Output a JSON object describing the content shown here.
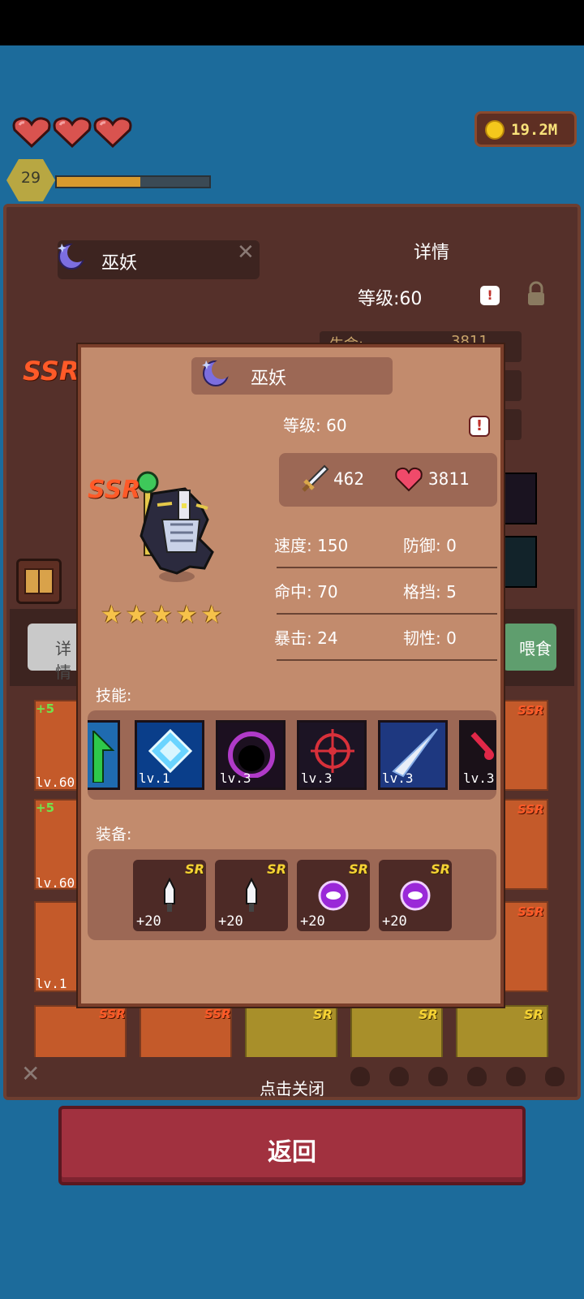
{
  "hud": {
    "hearts": 3,
    "gold": "19.2M",
    "player_level": "29",
    "xp_fraction": 0.55
  },
  "background_panel": {
    "hero_name": "巫妖",
    "detail_title": "详情",
    "level_label": "等级:60",
    "row1_label": "生命:",
    "row1_value": "3811",
    "tab_left": "详情",
    "tab_right": "喂食",
    "cards": [
      {
        "lv": "lv.60",
        "bonus": "+5"
      },
      {
        "lv": "lv.60",
        "bonus": "+5"
      },
      {
        "lv": "lv.1",
        "bonus": ""
      }
    ],
    "rarity_ssr": "SSR",
    "rarity_sr": "SR"
  },
  "popup": {
    "name": "巫妖",
    "level": "等级: 60",
    "rarity": "SSR",
    "stars": 5,
    "attack": "462",
    "hp": "3811",
    "stats": [
      [
        "速度: 150",
        "防御: 0"
      ],
      [
        "命中: 70",
        "格挡: 5"
      ],
      [
        "暴击: 24",
        "韧性: 0"
      ]
    ],
    "skills_label": "技能:",
    "skills": [
      {
        "lv": "",
        "icon": "green-arrow-icon"
      },
      {
        "lv": "lv.1",
        "icon": "blue-crystal-icon"
      },
      {
        "lv": "lv.3",
        "icon": "dark-vortex-icon"
      },
      {
        "lv": "lv.3",
        "icon": "crosshair-icon"
      },
      {
        "lv": "lv.3",
        "icon": "blade-slash-icon"
      },
      {
        "lv": "lv.3",
        "icon": "blood-drop-icon"
      }
    ],
    "equipment_label": "装备:",
    "equipment": [
      {
        "plus": "+20",
        "rarity": "SR",
        "icon": "dagger-icon"
      },
      {
        "plus": "+20",
        "rarity": "SR",
        "icon": "dagger-icon"
      },
      {
        "plus": "+20",
        "rarity": "SR",
        "icon": "purple-ring-icon"
      },
      {
        "plus": "+20",
        "rarity": "SR",
        "icon": "purple-ring-icon"
      }
    ]
  },
  "close_hint": "点击关闭",
  "back_button": "返回"
}
